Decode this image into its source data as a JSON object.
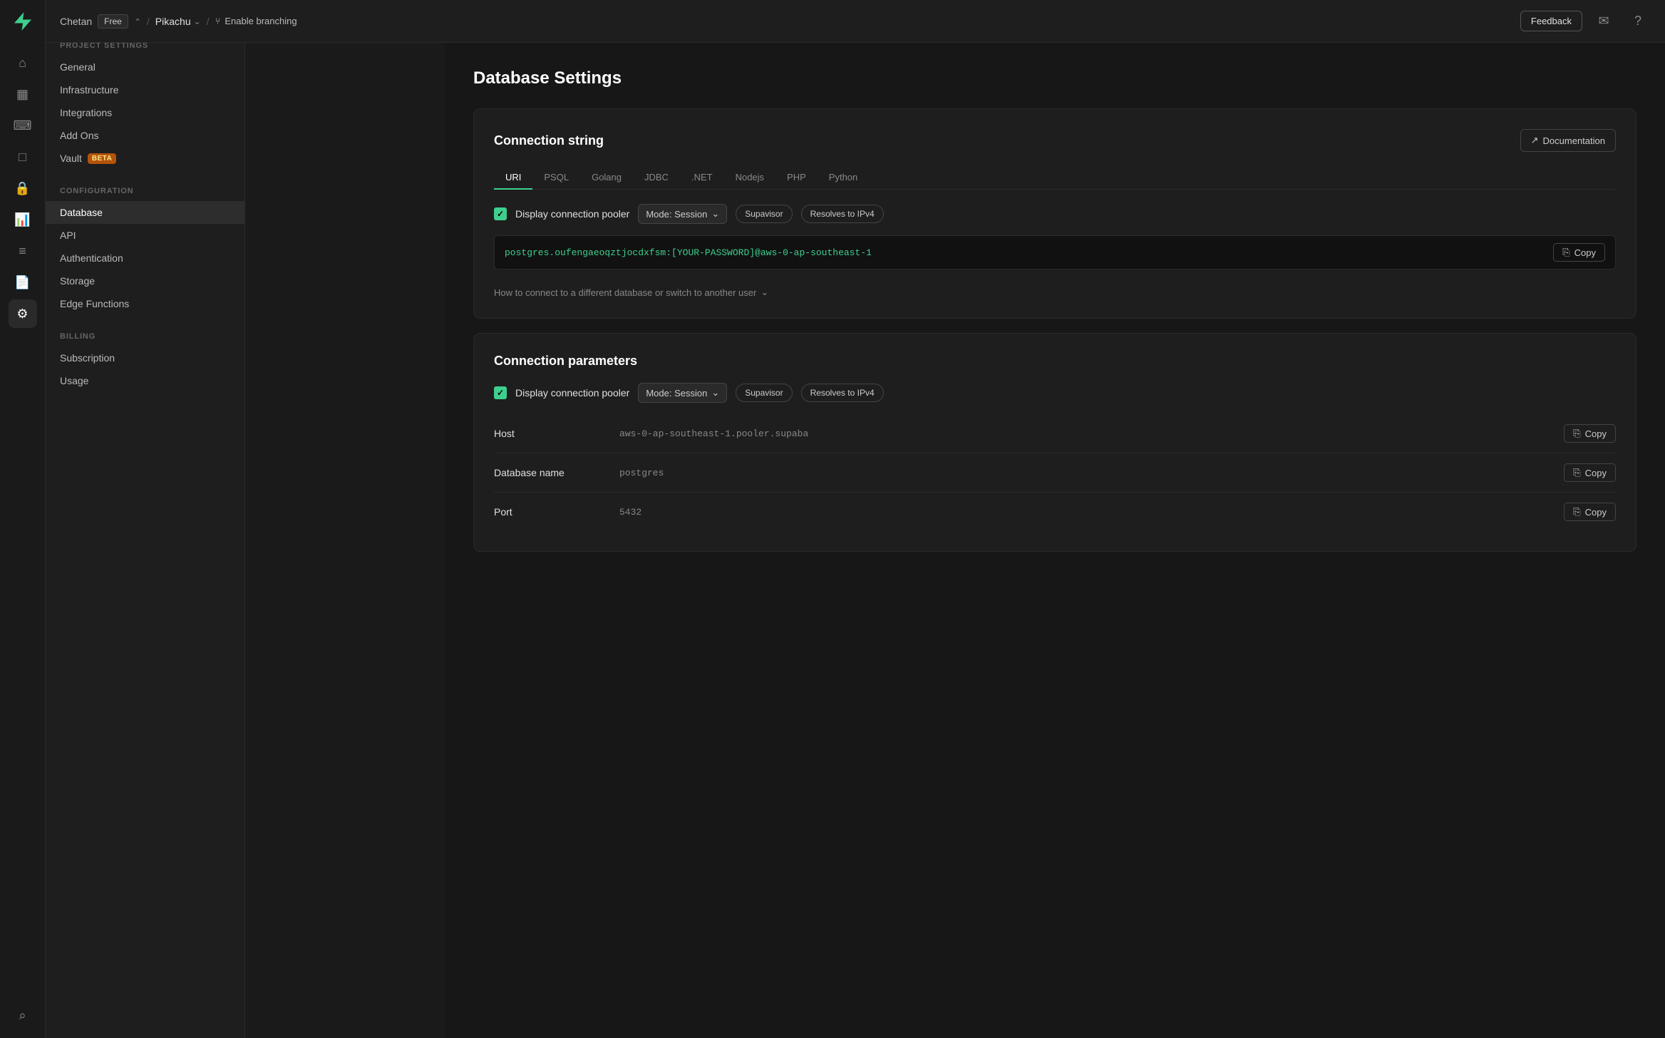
{
  "logo": {
    "alt": "Supabase logo"
  },
  "topbar": {
    "project": "Chetan",
    "badge": "Free",
    "slash1": "/",
    "project_name": "Pikachu",
    "slash2": "/",
    "branch_label": "Enable branching",
    "feedback_label": "Feedback"
  },
  "sidebar": {
    "settings_label": "Settings",
    "sections": [
      {
        "title": "PROJECT SETTINGS",
        "items": [
          {
            "label": "General",
            "active": false
          },
          {
            "label": "Infrastructure",
            "active": false
          },
          {
            "label": "Integrations",
            "active": false
          },
          {
            "label": "Add Ons",
            "active": false
          },
          {
            "label": "Vault",
            "active": false,
            "badge": "BETA"
          }
        ]
      },
      {
        "title": "CONFIGURATION",
        "items": [
          {
            "label": "Database",
            "active": true
          },
          {
            "label": "API",
            "active": false
          },
          {
            "label": "Authentication",
            "active": false
          },
          {
            "label": "Storage",
            "active": false
          },
          {
            "label": "Edge Functions",
            "active": false
          }
        ]
      },
      {
        "title": "BILLING",
        "items": [
          {
            "label": "Subscription",
            "active": false
          },
          {
            "label": "Usage",
            "active": false
          }
        ]
      }
    ]
  },
  "main": {
    "page_title": "Database Settings",
    "connection_string": {
      "title": "Connection string",
      "doc_btn": "Documentation",
      "tabs": [
        "URI",
        "PSQL",
        "Golang",
        "JDBC",
        ".NET",
        "Nodejs",
        "PHP",
        "Python"
      ],
      "active_tab": "URI",
      "display_pooler_label": "Display connection pooler",
      "mode_select": "Mode: Session",
      "supavisor_label": "Supavisor",
      "resolves_label": "Resolves to IPv4",
      "connection_value": "postgres.oufengaeoqztjocdxfsm:[YOUR-PASSWORD]@aws-0-ap-southeast-1",
      "copy_label": "Copy",
      "how_to_label": "How to connect to a different database or switch to another user"
    },
    "connection_params": {
      "title": "Connection parameters",
      "display_pooler_label": "Display connection pooler",
      "mode_select": "Mode: Session",
      "supavisor_label": "Supavisor",
      "resolves_label": "Resolves to IPv4",
      "params": [
        {
          "label": "Host",
          "value": "aws-0-ap-southeast-1.pooler.supaba",
          "copy_label": "Copy"
        },
        {
          "label": "Database name",
          "value": "postgres",
          "copy_label": "Copy"
        },
        {
          "label": "Port",
          "value": "5432",
          "copy_label": "Copy"
        }
      ]
    }
  },
  "icons": {
    "home": "⌂",
    "table": "▦",
    "terminal": "⌨",
    "storage": "□",
    "settings": "⚙",
    "search": "⌕",
    "notification": "✉",
    "help": "?",
    "chevron_down": "⌄",
    "branch": "⑂",
    "external_link": "↗",
    "copy_icon": "⎘",
    "check": "✓"
  }
}
